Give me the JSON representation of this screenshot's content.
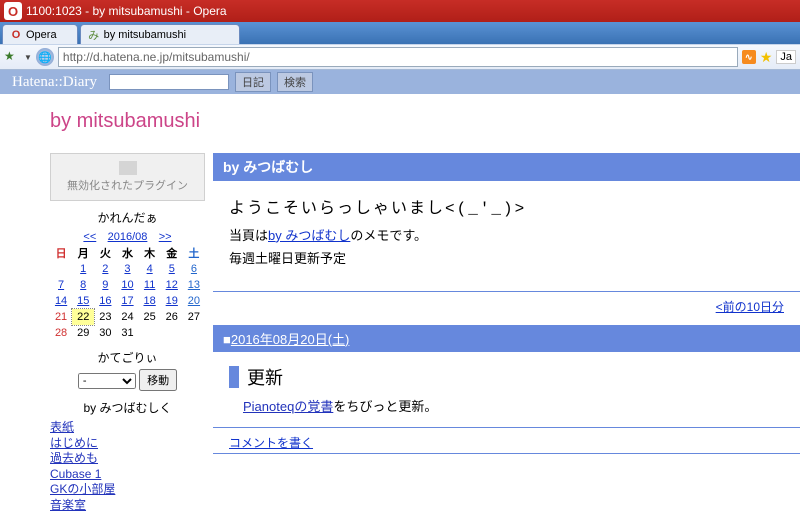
{
  "window": {
    "title": "1100:1023 - by mitsubamushi - Opera"
  },
  "tabs": [
    {
      "label": "Opera"
    },
    {
      "label": "by mitsubamushi"
    }
  ],
  "addressbar": {
    "url": "http://d.hatena.ne.jp/mitsubamushi/",
    "right_label": "Ja"
  },
  "hatena": {
    "logo": "Hatena::Diary",
    "btn_diary": "日記",
    "btn_search": "検索"
  },
  "blog_title": "by mitsubamushi",
  "plugin_disabled": "無効化されたプラグイン",
  "calendar": {
    "head": "かれんだぁ",
    "prev": "<<",
    "month": "2016/08",
    "next": ">>",
    "dow": [
      "日",
      "月",
      "火",
      "水",
      "木",
      "金",
      "土"
    ],
    "weeks": [
      [
        "",
        "1",
        "2",
        "3",
        "4",
        "5",
        "6"
      ],
      [
        "7",
        "8",
        "9",
        "10",
        "11",
        "12",
        "13"
      ],
      [
        "14",
        "15",
        "16",
        "17",
        "18",
        "19",
        "20"
      ],
      [
        "21",
        "22",
        "23",
        "24",
        "25",
        "26",
        "27"
      ],
      [
        "28",
        "29",
        "30",
        "31",
        "",
        "",
        ""
      ]
    ],
    "today": "22",
    "linked_max": 20
  },
  "category": {
    "head": "かてごりぃ",
    "opt": "-",
    "btn": "移動"
  },
  "linklist": {
    "head": "by みつばむしく",
    "items": [
      "表紙",
      "はじめに",
      "過去めも",
      "Cubase 1",
      "GKの小部屋",
      "音楽室"
    ]
  },
  "about": {
    "title": "by みつばむし",
    "welcome": "ようこそいらっしゃいまし<(_'_)>",
    "line2_pre": "当頁は",
    "line2_link": "by みつばむし",
    "line2_post": "のメモです。",
    "line3": "毎週土曜日更新予定"
  },
  "prev_link": "<前の10日分",
  "entry": {
    "date": "2016年08月20日(土)",
    "title": "更新",
    "body_link": "Pianoteqの覚書",
    "body_post": "をちびっと更新。",
    "comment": "コメントを書く"
  }
}
